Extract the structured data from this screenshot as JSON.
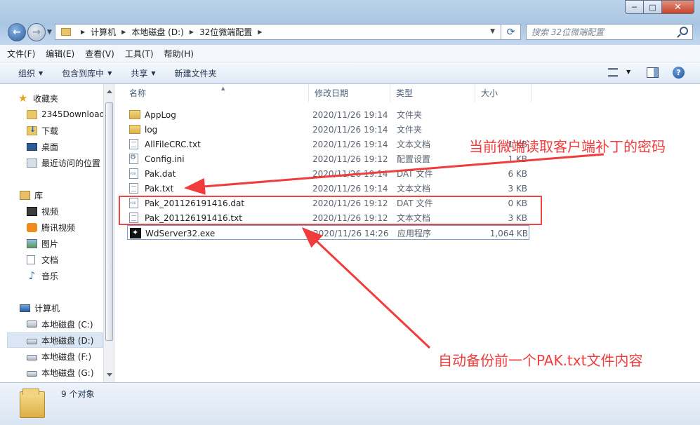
{
  "window": {
    "minimize": "─",
    "maximize": "□",
    "close": "✕"
  },
  "address": {
    "crumbs": [
      "计算机",
      "本地磁盘 (D:)",
      "32位微端配置"
    ],
    "search_placeholder": "搜索 32位微端配置"
  },
  "menu": [
    "文件(F)",
    "编辑(E)",
    "查看(V)",
    "工具(T)",
    "帮助(H)"
  ],
  "toolbar": {
    "organize": "组织",
    "include_library": "包含到库中",
    "share": "共享",
    "new_folder": "新建文件夹"
  },
  "nav": {
    "favorites": "收藏夹",
    "fav_items": [
      "2345Download",
      "下载",
      "桌面",
      "最近访问的位置"
    ],
    "libraries": "库",
    "lib_items": [
      "视频",
      "腾讯视频",
      "图片",
      "文档",
      "音乐"
    ],
    "computer": "计算机",
    "drives": [
      "本地磁盘 (C:)",
      "本地磁盘 (D:)",
      "本地磁盘 (F:)",
      "本地磁盘 (G:)"
    ]
  },
  "columns": {
    "name": "名称",
    "date": "修改日期",
    "type": "类型",
    "size": "大小"
  },
  "files": [
    {
      "name": "AppLog",
      "date": "2020/11/26 19:14",
      "type": "文件夹",
      "size": "",
      "icon": "folder-icon"
    },
    {
      "name": "log",
      "date": "2020/11/26 19:14",
      "type": "文件夹",
      "size": "",
      "icon": "folder-icon"
    },
    {
      "name": "AllFileCRC.txt",
      "date": "2020/11/26 19:14",
      "type": "文本文档",
      "size": "1 KB",
      "icon": "text-file-icon"
    },
    {
      "name": "Config.ini",
      "date": "2020/11/26 19:12",
      "type": "配置设置",
      "size": "1 KB",
      "icon": "config-file-icon"
    },
    {
      "name": "Pak.dat",
      "date": "2020/11/26 19:14",
      "type": "DAT 文件",
      "size": "6 KB",
      "icon": "dat-file-icon"
    },
    {
      "name": "Pak.txt",
      "date": "2020/11/26 19:14",
      "type": "文本文档",
      "size": "3 KB",
      "icon": "text-file-icon"
    },
    {
      "name": "Pak_201126191416.dat",
      "date": "2020/11/26 19:12",
      "type": "DAT 文件",
      "size": "0 KB",
      "icon": "dat-file-icon"
    },
    {
      "name": "Pak_201126191416.txt",
      "date": "2020/11/26 19:12",
      "type": "文本文档",
      "size": "3 KB",
      "icon": "text-file-icon"
    },
    {
      "name": "WdServer32.exe",
      "date": "2020/11/26 14:26",
      "type": "应用程序",
      "size": "1,064 KB",
      "icon": "exe-file-icon"
    }
  ],
  "annotations": {
    "top": "当前微端读取客户端补丁的密码",
    "bottom": "自动备份前一个PAK.txt文件内容",
    "color": "#f03c3c"
  },
  "status": {
    "count": "9 个对象"
  }
}
